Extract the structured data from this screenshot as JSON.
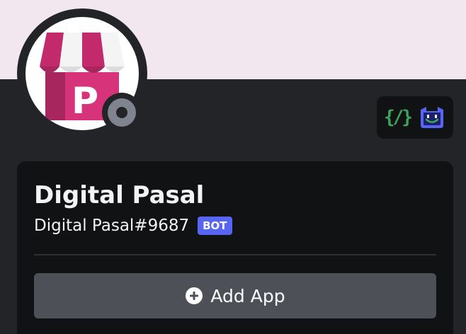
{
  "profile": {
    "display_name": "Digital Pasal",
    "username": "Digital Pasal#9687",
    "bot_tag": "BOT",
    "status": "offline",
    "avatar_letter": "P"
  },
  "badges": [
    "developer-badge-icon",
    "bot-badge-icon"
  ],
  "badge_text": {
    "developer": "{/}"
  },
  "actions": {
    "add_app_label": "Add App"
  },
  "colors": {
    "banner": "#f2e6ef",
    "background": "#232428",
    "card": "#111214",
    "bot_tag": "#5865f2",
    "button": "#4e5058",
    "avatar_accent": "#d6337a",
    "status": "#80848e"
  }
}
